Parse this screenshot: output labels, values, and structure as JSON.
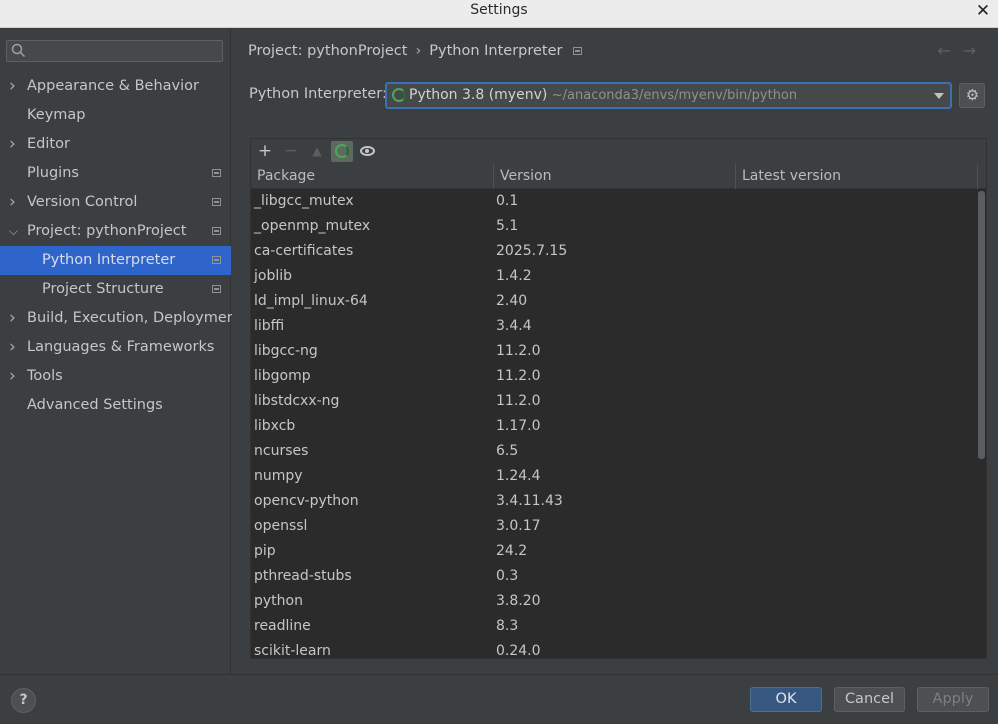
{
  "window": {
    "title": "Settings",
    "close_label": "✕"
  },
  "sidebar": {
    "search_placeholder": "",
    "items": [
      {
        "label": "Appearance & Behavior",
        "expandable": true,
        "expanded": false
      },
      {
        "label": "Keymap",
        "expandable": false
      },
      {
        "label": "Editor",
        "expandable": true,
        "expanded": false
      },
      {
        "label": "Plugins",
        "expandable": false,
        "project_icon": true
      },
      {
        "label": "Version Control",
        "expandable": true,
        "expanded": false,
        "project_icon": true
      },
      {
        "label": "Project: pythonProject",
        "expandable": true,
        "expanded": true,
        "project_icon": true
      },
      {
        "label": "Python Interpreter",
        "child": true,
        "selected": true,
        "project_icon": true
      },
      {
        "label": "Project Structure",
        "child": true,
        "project_icon": true
      },
      {
        "label": "Build, Execution, Deployment",
        "expandable": true,
        "expanded": false
      },
      {
        "label": "Languages & Frameworks",
        "expandable": true,
        "expanded": false
      },
      {
        "label": "Tools",
        "expandable": true,
        "expanded": false
      },
      {
        "label": "Advanced Settings",
        "expandable": false
      }
    ]
  },
  "breadcrumb": {
    "project": "Project: pythonProject",
    "separator": "›",
    "page": "Python Interpreter"
  },
  "nav": {
    "back": "←",
    "forward": "→"
  },
  "interpreter": {
    "label": "Python Interpreter:",
    "name": "Python 3.8 (myenv)",
    "path": "~/anaconda3/envs/myenv/bin/python"
  },
  "toolbar": {
    "add": "+",
    "remove": "−",
    "upgrade": "▲"
  },
  "table": {
    "columns": [
      "Package",
      "Version",
      "Latest version"
    ],
    "rows": [
      {
        "package": "_libgcc_mutex",
        "version": "0.1",
        "latest": ""
      },
      {
        "package": "_openmp_mutex",
        "version": "5.1",
        "latest": ""
      },
      {
        "package": "ca-certificates",
        "version": "2025.7.15",
        "latest": ""
      },
      {
        "package": "joblib",
        "version": "1.4.2",
        "latest": ""
      },
      {
        "package": "ld_impl_linux-64",
        "version": "2.40",
        "latest": ""
      },
      {
        "package": "libffi",
        "version": "3.4.4",
        "latest": ""
      },
      {
        "package": "libgcc-ng",
        "version": "11.2.0",
        "latest": ""
      },
      {
        "package": "libgomp",
        "version": "11.2.0",
        "latest": ""
      },
      {
        "package": "libstdcxx-ng",
        "version": "11.2.0",
        "latest": ""
      },
      {
        "package": "libxcb",
        "version": "1.17.0",
        "latest": ""
      },
      {
        "package": "ncurses",
        "version": "6.5",
        "latest": ""
      },
      {
        "package": "numpy",
        "version": "1.24.4",
        "latest": ""
      },
      {
        "package": "opencv-python",
        "version": "3.4.11.43",
        "latest": ""
      },
      {
        "package": "openssl",
        "version": "3.0.17",
        "latest": ""
      },
      {
        "package": "pip",
        "version": "24.2",
        "latest": ""
      },
      {
        "package": "pthread-stubs",
        "version": "0.3",
        "latest": ""
      },
      {
        "package": "python",
        "version": "3.8.20",
        "latest": ""
      },
      {
        "package": "readline",
        "version": "8.3",
        "latest": ""
      },
      {
        "package": "scikit-learn",
        "version": "0.24.0",
        "latest": ""
      }
    ]
  },
  "footer": {
    "help": "?",
    "ok": "OK",
    "cancel": "Cancel",
    "apply": "Apply"
  },
  "colors": {
    "accent": "#2f65ca",
    "ok_button": "#365880",
    "focus_border": "#3d6fb5",
    "spinner": "#48a85a"
  }
}
